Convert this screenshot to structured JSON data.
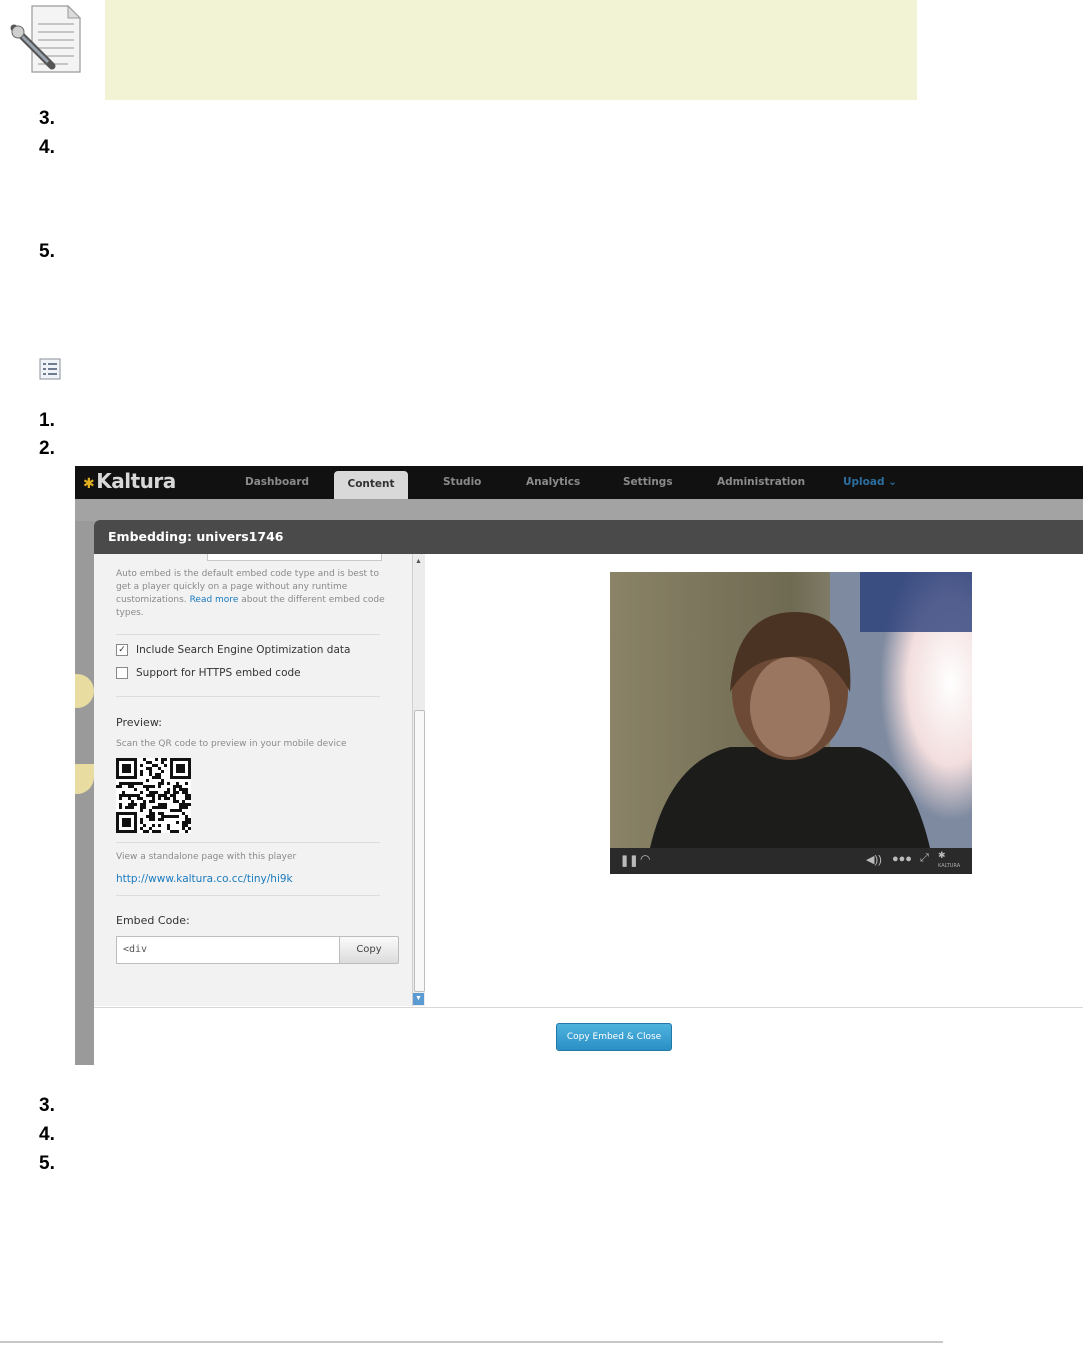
{
  "steps_top": [
    "3.",
    "4.",
    "5."
  ],
  "steps_mid": [
    "1.",
    "2."
  ],
  "steps_bottom": [
    "3.",
    "4.",
    "5."
  ],
  "screenshot": {
    "brand": "Kaltura",
    "nav": {
      "dashboard": "Dashboard",
      "content": "Content",
      "studio": "Studio",
      "analytics": "Analytics",
      "settings": "Settings",
      "administration": "Administration",
      "upload": "Upload"
    },
    "modal": {
      "title": "Embedding: univers1746",
      "auto_embed_text_before": "Auto embed is the default embed code type and is best to get a player quickly on a page without any runtime customizations.",
      "read_more": "Read more",
      "auto_embed_text_after": "about the different embed code types.",
      "seo_label": "Include Search Engine Optimization data",
      "https_label": "Support for HTTPS embed code",
      "preview_label": "Preview:",
      "qr_text": "Scan the QR code to preview in your mobile device",
      "standalone_text": "View a standalone page with this player",
      "standalone_link": "http://www.kaltura.co.cc/tiny/hi9k",
      "embed_code_label": "Embed Code:",
      "embed_code_value": "<div",
      "copy_label": "Copy",
      "copy_close_label": "Copy Embed & Close"
    },
    "player": {
      "brand_small": "KALTURA"
    }
  },
  "colors": {
    "note_background": "#f2f2d5",
    "link_blue": "#1a7bbf",
    "primary_button": "#2a8fc5"
  }
}
